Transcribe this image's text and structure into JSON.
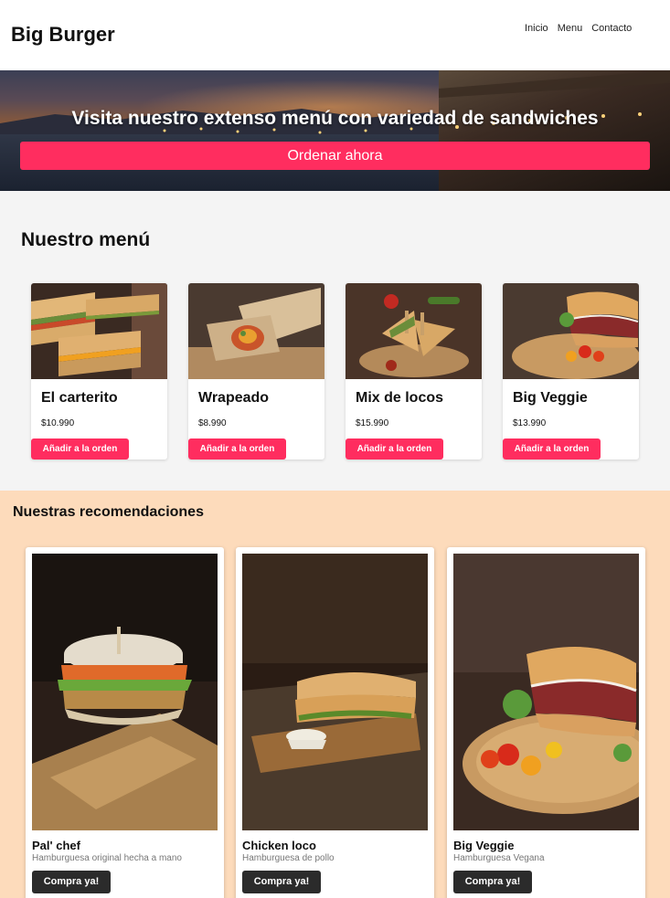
{
  "header": {
    "brand": "Big Burger",
    "nav": [
      "Inicio",
      "Menu",
      "Contacto"
    ]
  },
  "hero": {
    "title": "Visita nuestro extenso menú con variedad de sandwiches",
    "cta": "Ordenar ahora"
  },
  "menu": {
    "title": "Nuestro menú",
    "items": [
      {
        "name": "El carterito",
        "price": "$10.990",
        "button": "Añadir a la orden"
      },
      {
        "name": "Wrapeado",
        "price": "$8.990",
        "button": "Añadir a la orden"
      },
      {
        "name": "Mix de locos",
        "price": "$15.990",
        "button": "Añadir a la orden"
      },
      {
        "name": "Big Veggie",
        "price": "$13.990",
        "button": "Añadir a la orden"
      }
    ]
  },
  "recommendations": {
    "title": "Nuestras recomendaciones",
    "items": [
      {
        "name": "Pal' chef",
        "subtitle": "Hamburguesa original hecha a mano",
        "button": "Compra ya!"
      },
      {
        "name": "Chicken loco",
        "subtitle": "Hamburguesa de pollo",
        "button": "Compra ya!"
      },
      {
        "name": "Big Veggie",
        "subtitle": "Hamburguesa Vegana",
        "button": "Compra ya!"
      }
    ]
  },
  "colors": {
    "accent": "#ff2d5f",
    "menu_bg": "#f4f4f4",
    "rec_bg": "#fddbbb",
    "dark_button": "#2b2b2b"
  }
}
